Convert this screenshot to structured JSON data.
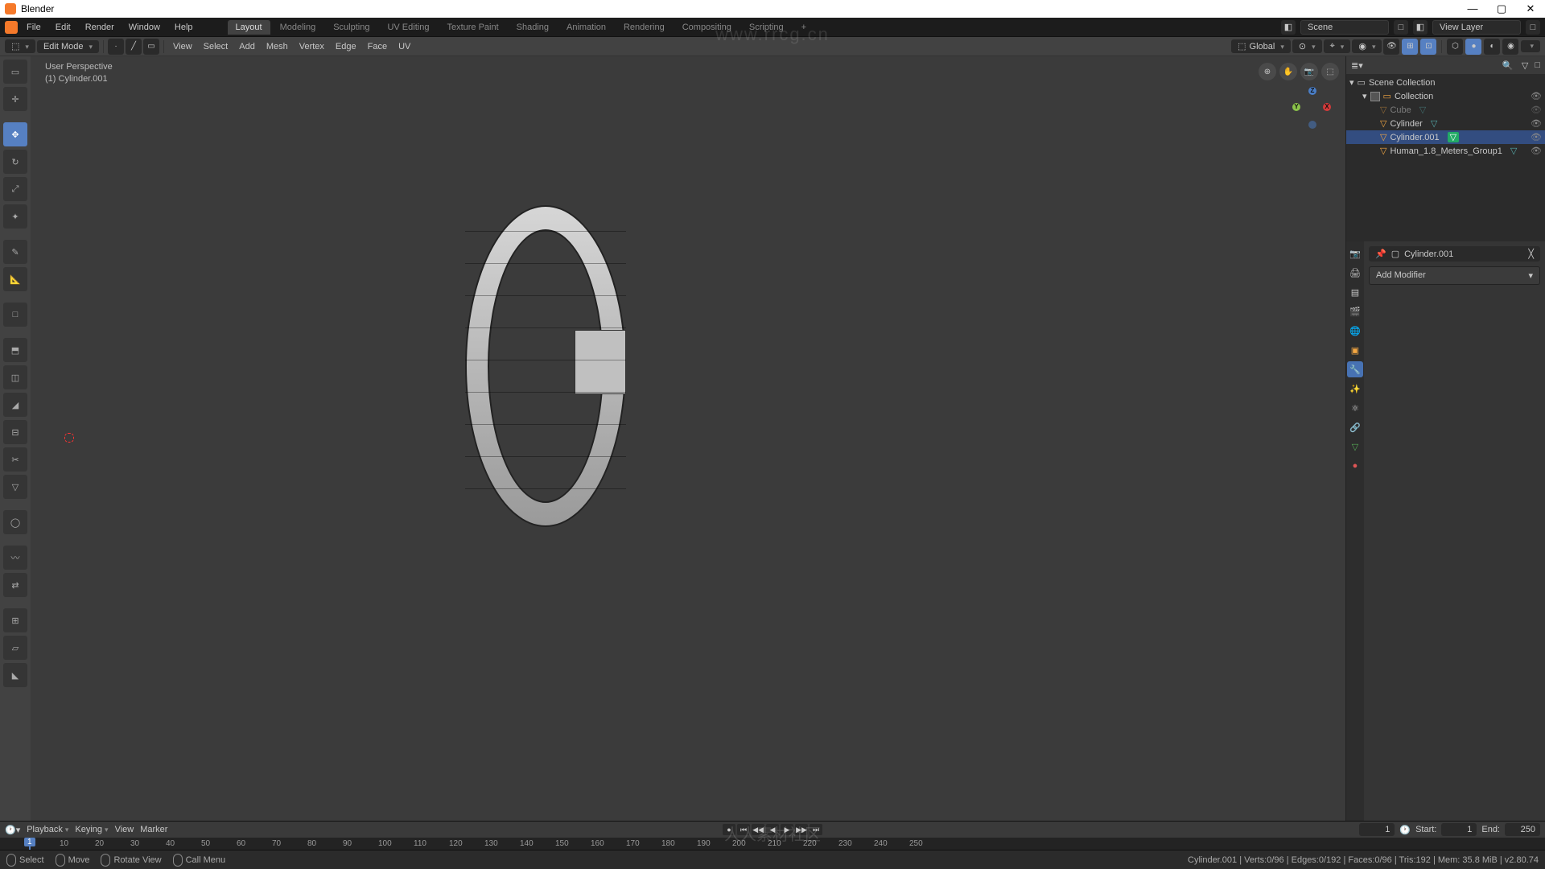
{
  "app": {
    "title": "Blender"
  },
  "menu": {
    "items": [
      "File",
      "Edit",
      "Render",
      "Window",
      "Help"
    ]
  },
  "workspaces": {
    "tabs": [
      "Layout",
      "Modeling",
      "Sculpting",
      "UV Editing",
      "Texture Paint",
      "Shading",
      "Animation",
      "Rendering",
      "Compositing",
      "Scripting"
    ],
    "active": "Layout",
    "add": "+"
  },
  "header_right": {
    "scene_label": "Scene",
    "viewlayer_label": "View Layer"
  },
  "viewport_header": {
    "mode": "Edit Mode",
    "menus": [
      "View",
      "Select",
      "Add",
      "Mesh",
      "Vertex",
      "Edge",
      "Face",
      "UV"
    ],
    "orient": "Global"
  },
  "viewport_overlay": {
    "line1": "User Perspective",
    "line2": "(1) Cylinder.001"
  },
  "outliner": {
    "root": "Scene Collection",
    "collection": "Collection",
    "items": [
      {
        "name": "Cube",
        "dim": true
      },
      {
        "name": "Cylinder",
        "dim": false
      },
      {
        "name": "Cylinder.001",
        "dim": false,
        "selected": true
      },
      {
        "name": "Human_1.8_Meters_Group1",
        "dim": false
      }
    ]
  },
  "properties": {
    "object_name": "Cylinder.001",
    "add_modifier": "Add Modifier"
  },
  "timeline": {
    "menus": [
      "Playback",
      "Keying",
      "View",
      "Marker"
    ],
    "current": "1",
    "start_label": "Start:",
    "start": "1",
    "end_label": "End:",
    "end": "250",
    "ticks": [
      "10",
      "20",
      "30",
      "40",
      "50",
      "60",
      "70",
      "80",
      "90",
      "100",
      "110",
      "120",
      "130",
      "140",
      "150",
      "160",
      "170",
      "180",
      "190",
      "200",
      "210",
      "220",
      "230",
      "240",
      "250"
    ]
  },
  "statusbar": {
    "select": "Select",
    "move": "Move",
    "rotate": "Rotate View",
    "menu": "Call Menu",
    "right": "Cylinder.001 | Verts:0/96 | Edges:0/192 | Faces:0/96 | Tris:192 | Mem: 35.8 MiB | v2.80.74"
  },
  "watermark": {
    "url": "www.rrcg.cn",
    "text": "人人素材社区"
  }
}
